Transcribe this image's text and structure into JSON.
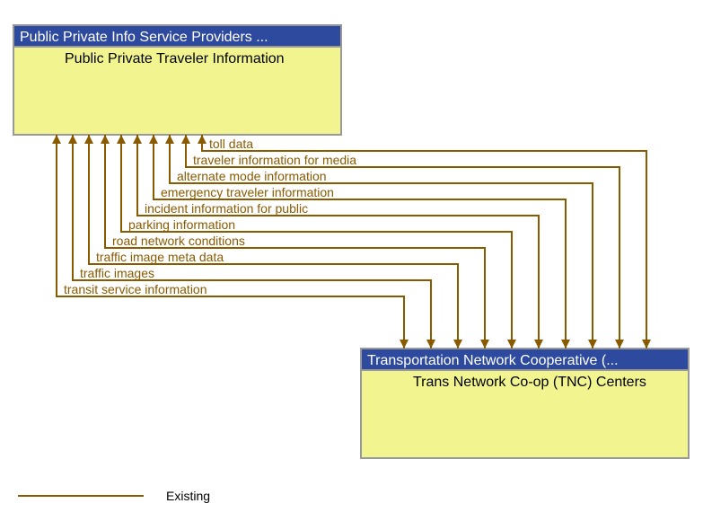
{
  "boxes": {
    "source": {
      "title": "Public Private Info Service Providers ...",
      "body": "Public Private Traveler Information"
    },
    "target": {
      "title": "Transportation Network Cooperative (...",
      "body": "Trans Network Co-op (TNC) Centers"
    }
  },
  "flows": [
    "toll data",
    "traveler information for media",
    "alternate mode information",
    "emergency traveler information",
    "incident information for public",
    "parking information",
    "road network conditions",
    "traffic image meta data",
    "traffic images",
    "transit service information"
  ],
  "legend": {
    "existing": "Existing"
  }
}
